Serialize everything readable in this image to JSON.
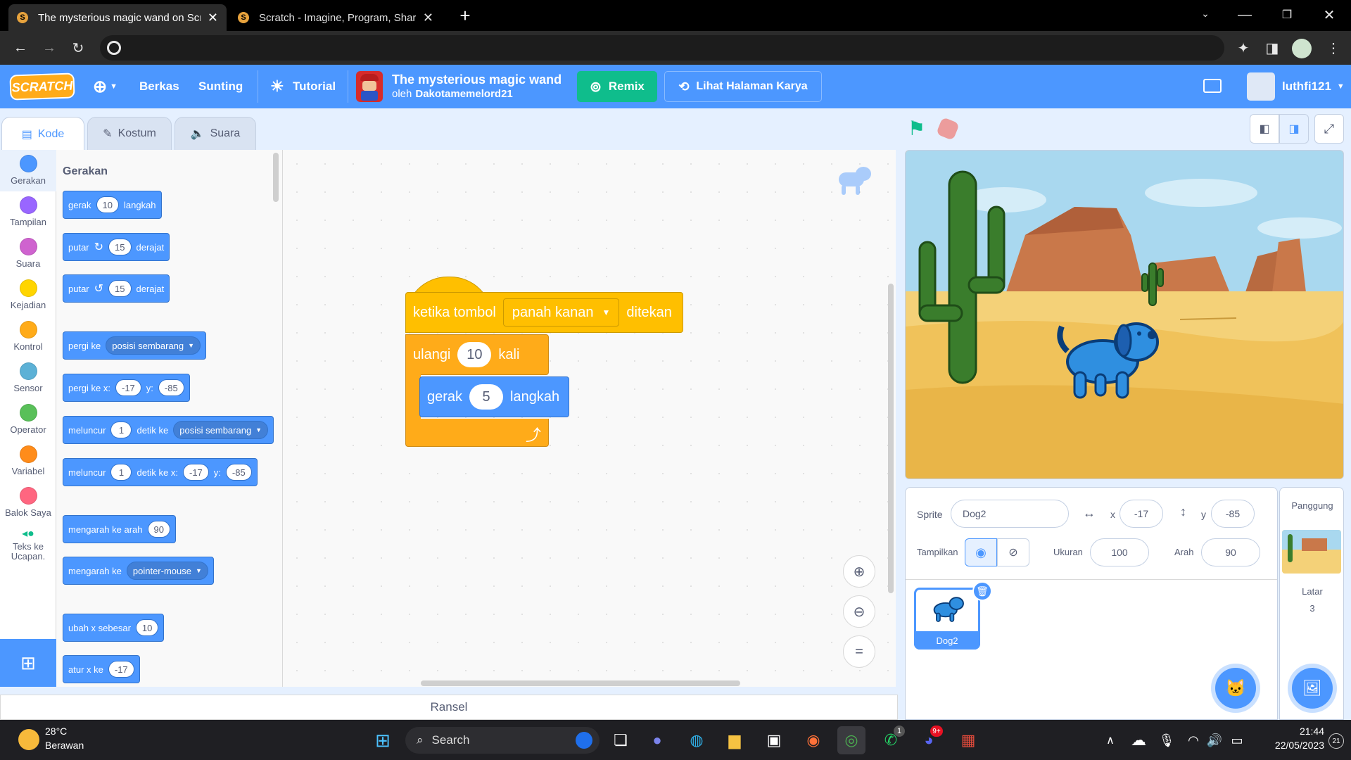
{
  "browser": {
    "tabs": [
      {
        "title": "The mysterious magic wand on Scratch",
        "active": true
      },
      {
        "title": "Scratch - Imagine, Program, Share",
        "active": false
      }
    ],
    "new_tab": "+",
    "url": ""
  },
  "menu": {
    "logo": "SCRATCH",
    "file": "Berkas",
    "edit": "Sunting",
    "tutorial": "Tutorial",
    "project_title": "The mysterious magic wand",
    "by_prefix": "oleh",
    "author": "Dakotamemelord21",
    "remix": "Remix",
    "see_project_page": "Lihat Halaman Karya",
    "username": "luthfi121"
  },
  "editor_tabs": {
    "code": "Kode",
    "costume": "Kostum",
    "sound": "Suara"
  },
  "categories": [
    {
      "label": "Gerakan",
      "color": "#4c97ff"
    },
    {
      "label": "Tampilan",
      "color": "#9966ff"
    },
    {
      "label": "Suara",
      "color": "#cf63cf"
    },
    {
      "label": "Kejadian",
      "color": "#ffd500"
    },
    {
      "label": "Kontrol",
      "color": "#ffab19"
    },
    {
      "label": "Sensor",
      "color": "#5cb1d6"
    },
    {
      "label": "Operator",
      "color": "#59c059"
    },
    {
      "label": "Variabel",
      "color": "#ff8c1a"
    },
    {
      "label": "Balok Saya",
      "color": "#ff6680"
    },
    {
      "label": "Teks ke Ucapan.",
      "color": "#0fbd8c"
    }
  ],
  "palette": {
    "heading": "Gerakan",
    "b1": {
      "a": "gerak",
      "v": "10",
      "b": "langkah"
    },
    "b2": {
      "a": "putar",
      "v": "15",
      "b": "derajat"
    },
    "b3": {
      "a": "putar",
      "v": "15",
      "b": "derajat"
    },
    "b4": {
      "a": "pergi ke",
      "dd": "posisi sembarang"
    },
    "b5": {
      "a": "pergi ke x:",
      "x": "-17",
      "y_label": "y:",
      "y": "-85"
    },
    "b6": {
      "a": "meluncur",
      "v": "1",
      "b": "detik ke",
      "dd": "posisi sembarang"
    },
    "b7": {
      "a": "meluncur",
      "v": "1",
      "b": "detik ke x:",
      "x": "-17",
      "y_label": "y:",
      "y": "-85"
    },
    "b8": {
      "a": "mengarah ke arah",
      "v": "90"
    },
    "b9": {
      "a": "mengarah ke",
      "dd": "pointer-mouse"
    },
    "b10": {
      "a": "ubah x sebesar",
      "v": "10"
    },
    "b11": {
      "a": "atur x ke",
      "v": "-17"
    }
  },
  "script": {
    "hat_a": "ketika tombol",
    "hat_dd": "panah kanan",
    "hat_b": "ditekan",
    "repeat_a": "ulangi",
    "repeat_v": "10",
    "repeat_b": "kali",
    "move_a": "gerak",
    "move_v": "5",
    "move_b": "langkah"
  },
  "backpack": "Ransel",
  "sprite_info": {
    "sprite_label": "Sprite",
    "sprite_name": "Dog2",
    "x_label": "x",
    "x": "-17",
    "y_label": "y",
    "y": "-85",
    "show_label": "Tampilkan",
    "size_label": "Ukuran",
    "size": "100",
    "direction_label": "Arah",
    "direction": "90"
  },
  "sprites": [
    {
      "name": "Dog2",
      "selected": true
    }
  ],
  "stage_panel": {
    "title": "Panggung",
    "backdrops_label": "Latar",
    "backdrops_count": "3"
  },
  "taskbar": {
    "weather_temp": "28°C",
    "weather_desc": "Berawan",
    "search": "Search",
    "time": "21:44",
    "date": "22/05/2023",
    "notif_count": "21",
    "whatsapp_badge": "1",
    "discord_badge": "9+"
  },
  "colors": {
    "scratch_blue": "#4c97ff",
    "events": "#ffbf00",
    "control": "#ffab19",
    "remix_green": "#0fbd8c"
  }
}
